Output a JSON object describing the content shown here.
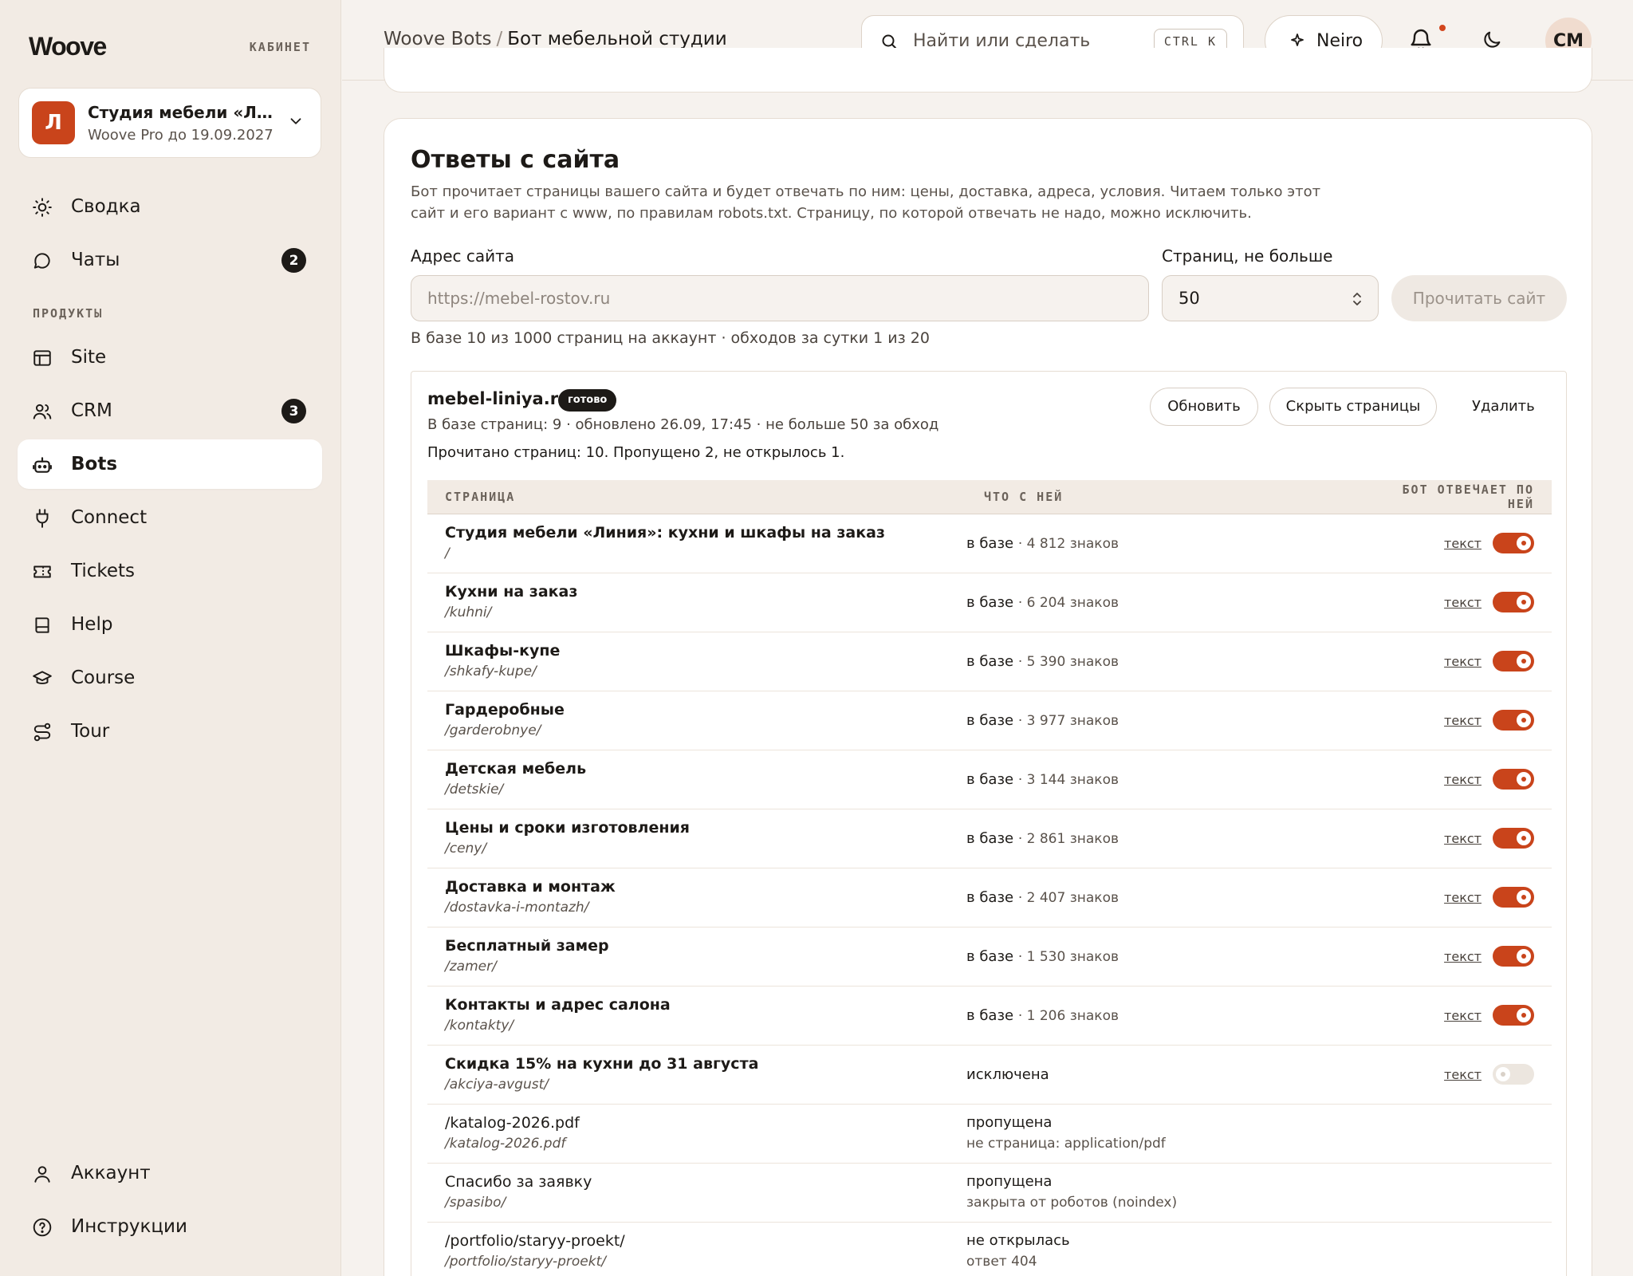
{
  "sidebar": {
    "logo": "Woove",
    "cabinet": "КАБИНЕТ",
    "org": {
      "initial": "Л",
      "name": "Студия мебели «Линия»",
      "plan": "Woove Pro до 19.09.2027"
    },
    "items_top": [
      {
        "label": "Сводка",
        "icon": "sun-icon"
      },
      {
        "label": "Чаты",
        "icon": "chat-icon",
        "badge": "2"
      }
    ],
    "section_label": "ПРОДУКТЫ",
    "products": [
      {
        "label": "Site",
        "icon": "layout-icon"
      },
      {
        "label": "CRM",
        "icon": "users-icon",
        "badge": "3"
      },
      {
        "label": "Bots",
        "icon": "bot-icon",
        "active": true
      },
      {
        "label": "Connect",
        "icon": "plug-icon"
      },
      {
        "label": "Tickets",
        "icon": "ticket-icon"
      },
      {
        "label": "Help",
        "icon": "book-icon"
      },
      {
        "label": "Course",
        "icon": "graduation-cap-icon"
      },
      {
        "label": "Tour",
        "icon": "route-icon"
      }
    ],
    "items_bottom": [
      {
        "label": "Аккаунт",
        "icon": "user-icon"
      },
      {
        "label": "Инструкции",
        "icon": "help-circle-icon"
      }
    ]
  },
  "topbar": {
    "crumb_root": "Woove Bots",
    "crumb_sep": "/",
    "crumb_current": "Бот мебельной студии",
    "search_placeholder": "Найти или сделать",
    "search_shortcut": "CTRL K",
    "neiro_label": "Neiro",
    "user_initials": "СМ"
  },
  "card": {
    "title": "Ответы с сайта",
    "description": "Бот прочитает страницы вашего сайта и будет отвечать по ним: цены, доставка, адреса, условия. Читаем только этот сайт и его вариант с www, по правилам robots.txt. Страницу, по которой отвечать не надо, можно исключить.",
    "url_label": "Адрес сайта",
    "url_placeholder": "https://mebel-rostov.ru",
    "pages_label": "Страниц, не больше",
    "pages_value": "50",
    "read_button": "Прочитать сайт",
    "quota": "В базе 10 из 1000 страниц на аккаунт · обходов за сутки 1 из 20"
  },
  "site": {
    "domain": "mebel-liniya.ru",
    "status": "готово",
    "meta": "В базе страниц: 9 · обновлено 26.09, 17:45 · не больше 50 за обход",
    "summary": "Прочитано страниц: 10. Пропущено 2, не открылось 1.",
    "refresh_button": "Обновить",
    "hide_button": "Скрыть страницы",
    "delete_button": "Удалить",
    "columns": [
      "СТРАНИЦА",
      "ЧТО С НЕЙ",
      "БОТ ОТВЕЧАЕТ ПО НЕЙ"
    ],
    "text_link": "текст",
    "rows": [
      {
        "title": "Студия мебели «Линия»: кухни и шкафы на заказ",
        "path": "/",
        "status": "в базе",
        "detail": "· 4 812 знаков",
        "toggle": true,
        "bold": true
      },
      {
        "title": "Кухни на заказ",
        "path": "/kuhni/",
        "status": "в базе",
        "detail": "· 6 204 знаков",
        "toggle": true,
        "bold": true
      },
      {
        "title": "Шкафы-купе",
        "path": "/shkafy-kupe/",
        "status": "в базе",
        "detail": "· 5 390 знаков",
        "toggle": true,
        "bold": true
      },
      {
        "title": "Гардеробные",
        "path": "/garderobnye/",
        "status": "в базе",
        "detail": "· 3 977 знаков",
        "toggle": true,
        "bold": true
      },
      {
        "title": "Детская мебель",
        "path": "/detskie/",
        "status": "в базе",
        "detail": "· 3 144 знаков",
        "toggle": true,
        "bold": true
      },
      {
        "title": "Цены и сроки изготовления",
        "path": "/ceny/",
        "status": "в базе",
        "detail": "· 2 861 знаков",
        "toggle": true,
        "bold": true
      },
      {
        "title": "Доставка и монтаж",
        "path": "/dostavka-i-montazh/",
        "status": "в базе",
        "detail": "· 2 407 знаков",
        "toggle": true,
        "bold": true
      },
      {
        "title": "Бесплатный замер",
        "path": "/zamer/",
        "status": "в базе",
        "detail": "· 1 530 знаков",
        "toggle": true,
        "bold": true
      },
      {
        "title": "Контакты и адрес салона",
        "path": "/kontakty/",
        "status": "в базе",
        "detail": "· 1 206 знаков",
        "toggle": true,
        "bold": true
      },
      {
        "title": "Скидка 15% на кухни до 31 августа",
        "path": "/akciya-avgust/",
        "status": "исключена",
        "detail": "",
        "toggle": false,
        "bold": true
      },
      {
        "title": "/katalog-2026.pdf",
        "path": "/katalog-2026.pdf",
        "status": "пропущена",
        "detail": "не страница: application/pdf",
        "bold": false
      },
      {
        "title": "Спасибо за заявку",
        "path": "/spasibo/",
        "status": "пропущена",
        "detail": "закрыта от роботов (noindex)",
        "bold": false
      },
      {
        "title": "/portfolio/staryy-proekt/",
        "path": "/portfolio/staryy-proekt/",
        "status": "не открылась",
        "detail": "ответ 404",
        "bold": false
      }
    ]
  },
  "colors": {
    "accent": "#c9441b",
    "sidebar_bg": "#f2ebe4",
    "page_bg": "#f6f2ee"
  }
}
